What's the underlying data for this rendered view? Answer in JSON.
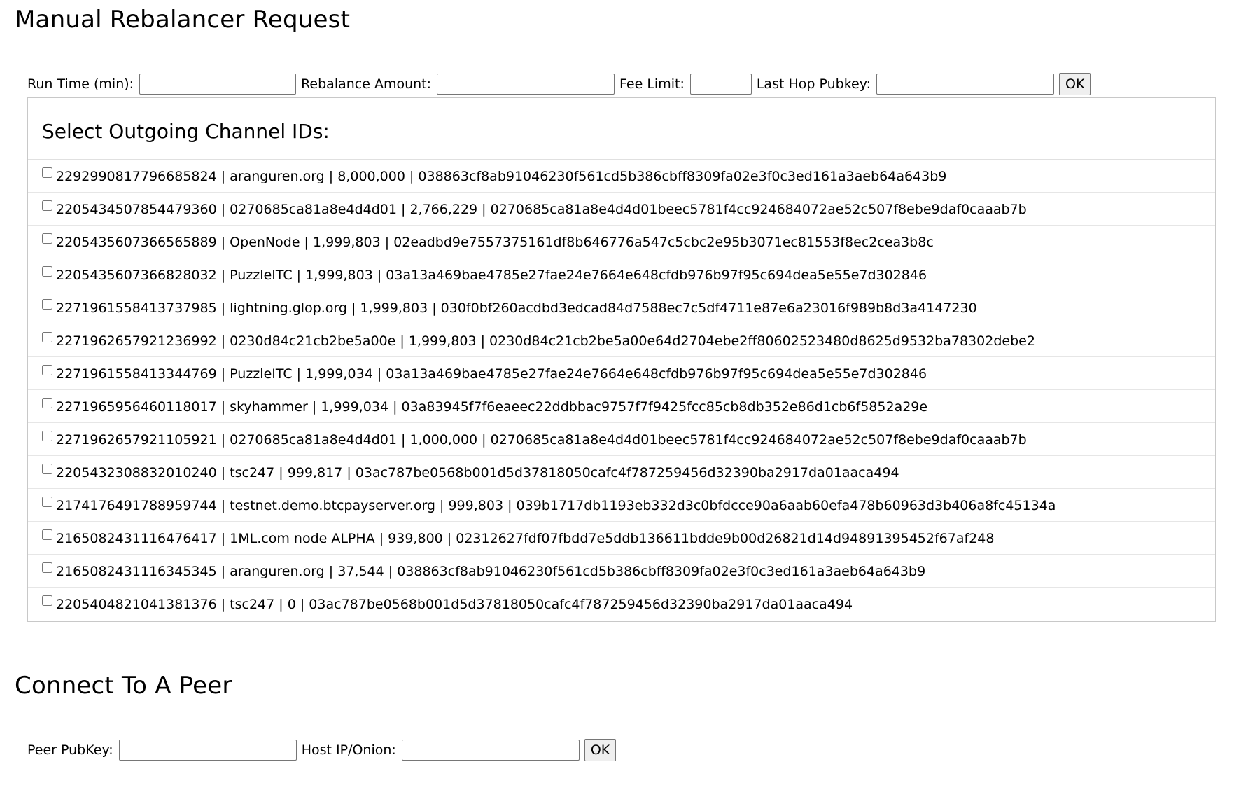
{
  "rebalancer": {
    "title": "Manual Rebalancer Request",
    "run_time_label": "Run Time (min):",
    "run_time_value": "",
    "amount_label": "Rebalance Amount:",
    "amount_value": "",
    "fee_limit_label": "Fee Limit:",
    "fee_limit_value": "",
    "last_hop_label": "Last Hop Pubkey:",
    "last_hop_value": "",
    "ok_label": "OK",
    "channels_title": "Select Outgoing Channel IDs:",
    "channels": [
      {
        "id": "2292990817796685824",
        "alias": "aranguren.org",
        "capacity": "8,000,000",
        "pubkey": "038863cf8ab91046230f561cd5b386cbff8309fa02e3f0c3ed161a3aeb64a643b9",
        "checked": false
      },
      {
        "id": "2205434507854479360",
        "alias": "0270685ca81a8e4d4d01",
        "capacity": "2,766,229",
        "pubkey": "0270685ca81a8e4d4d01beec5781f4cc924684072ae52c507f8ebe9daf0caaab7b",
        "checked": false
      },
      {
        "id": "2205435607366565889",
        "alias": "OpenNode",
        "capacity": "1,999,803",
        "pubkey": "02eadbd9e7557375161df8b646776a547c5cbc2e95b3071ec81553f8ec2cea3b8c",
        "checked": false
      },
      {
        "id": "2205435607366828032",
        "alias": "PuzzleITC",
        "capacity": "1,999,803",
        "pubkey": "03a13a469bae4785e27fae24e7664e648cfdb976b97f95c694dea5e55e7d302846",
        "checked": false
      },
      {
        "id": "2271961558413737985",
        "alias": "lightning.glop.org",
        "capacity": "1,999,803",
        "pubkey": "030f0bf260acdbd3edcad84d7588ec7c5df4711e87e6a23016f989b8d3a4147230",
        "checked": false
      },
      {
        "id": "2271962657921236992",
        "alias": "0230d84c21cb2be5a00e",
        "capacity": "1,999,803",
        "pubkey": "0230d84c21cb2be5a00e64d2704ebe2ff80602523480d8625d9532ba78302debe2",
        "checked": false
      },
      {
        "id": "2271961558413344769",
        "alias": "PuzzleITC",
        "capacity": "1,999,034",
        "pubkey": "03a13a469bae4785e27fae24e7664e648cfdb976b97f95c694dea5e55e7d302846",
        "checked": false
      },
      {
        "id": "2271965956460118017",
        "alias": "skyhammer",
        "capacity": "1,999,034",
        "pubkey": "03a83945f7f6eaeec22ddbbac9757f7f9425fcc85cb8db352e86d1cb6f5852a29e",
        "checked": false
      },
      {
        "id": "2271962657921105921",
        "alias": "0270685ca81a8e4d4d01",
        "capacity": "1,000,000",
        "pubkey": "0270685ca81a8e4d4d01beec5781f4cc924684072ae52c507f8ebe9daf0caaab7b",
        "checked": false
      },
      {
        "id": "2205432308832010240",
        "alias": "tsc247",
        "capacity": "999,817",
        "pubkey": "03ac787be0568b001d5d37818050cafc4f787259456d32390ba2917da01aaca494",
        "checked": false
      },
      {
        "id": "2174176491788959744",
        "alias": "testnet.demo.btcpayserver.org",
        "capacity": "999,803",
        "pubkey": "039b1717db1193eb332d3c0bfdcce90a6aab60efa478b60963d3b406a8fc45134a",
        "checked": false
      },
      {
        "id": "2165082431116476417",
        "alias": "1ML.com node ALPHA",
        "capacity": "939,800",
        "pubkey": "02312627fdf07fbdd7e5ddb136611bdde9b00d26821d14d94891395452f67af248",
        "checked": false
      },
      {
        "id": "2165082431116345345",
        "alias": "aranguren.org",
        "capacity": "37,544",
        "pubkey": "038863cf8ab91046230f561cd5b386cbff8309fa02e3f0c3ed161a3aeb64a643b9",
        "checked": false
      },
      {
        "id": "2205404821041381376",
        "alias": "tsc247",
        "capacity": "0",
        "pubkey": "03ac787be0568b001d5d37818050cafc4f787259456d32390ba2917da01aaca494",
        "checked": false
      }
    ]
  },
  "peer": {
    "title": "Connect To A Peer",
    "pubkey_label": "Peer PubKey:",
    "pubkey_value": "",
    "host_label": "Host IP/Onion:",
    "host_value": "",
    "ok_label": "OK"
  }
}
